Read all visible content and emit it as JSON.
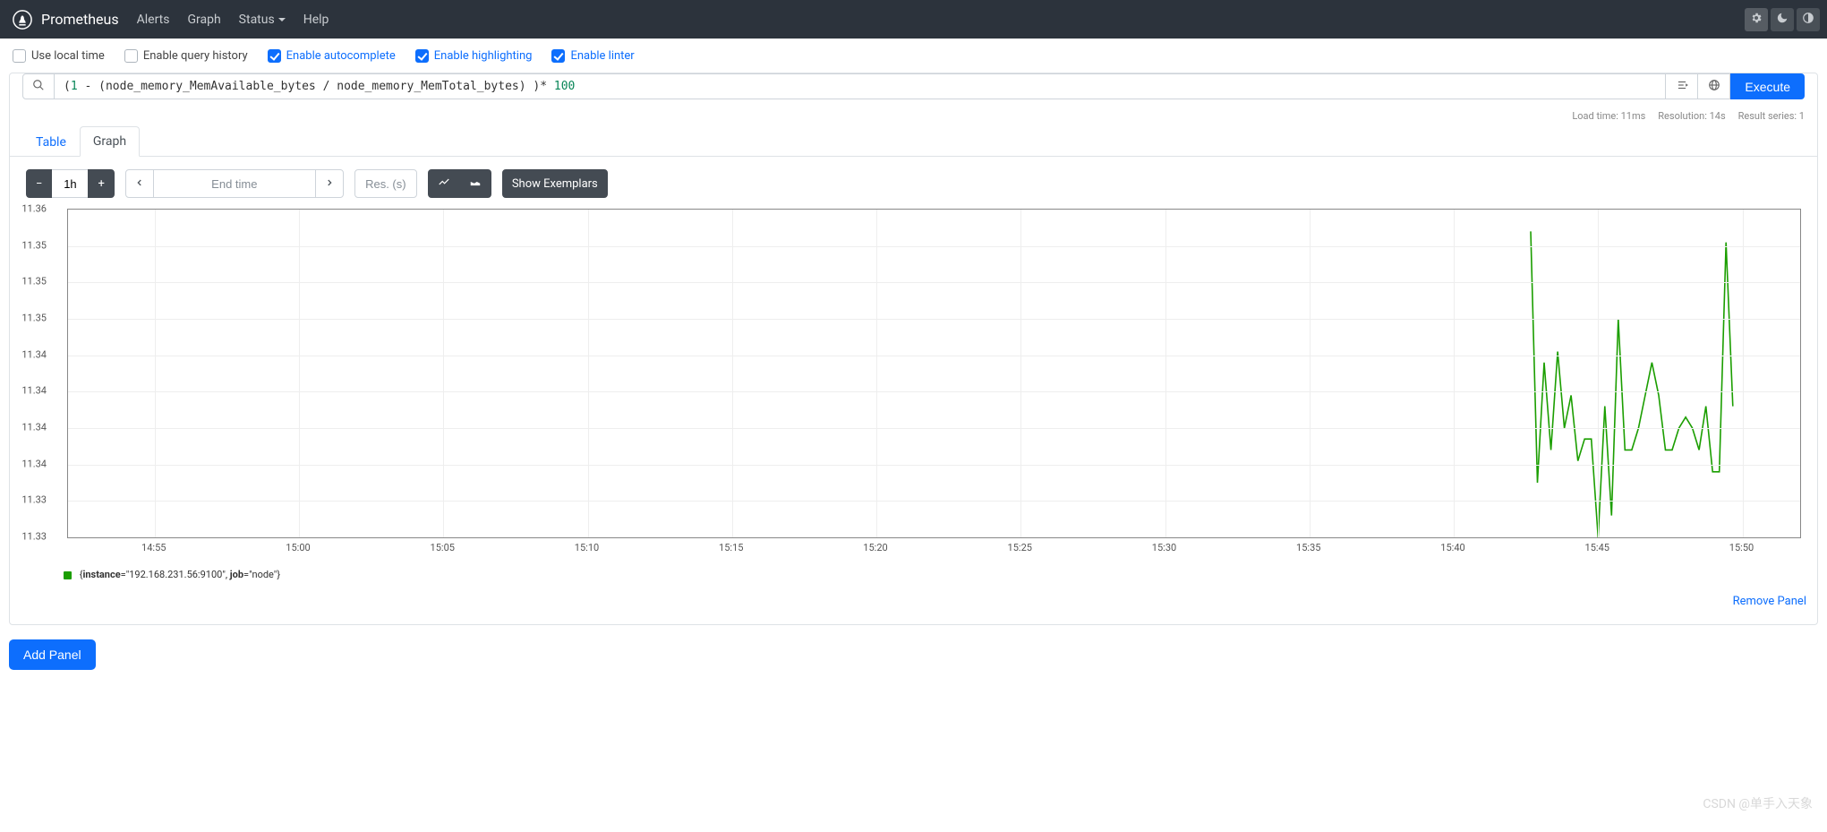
{
  "navbar": {
    "brand": "Prometheus",
    "links": [
      "Alerts",
      "Graph",
      "Status",
      "Help"
    ],
    "status_has_caret": true
  },
  "options": {
    "use_local_time": {
      "label": "Use local time",
      "checked": false
    },
    "enable_query_history": {
      "label": "Enable query history",
      "checked": false
    },
    "enable_autocomplete": {
      "label": "Enable autocomplete",
      "checked": true
    },
    "enable_highlighting": {
      "label": "Enable highlighting",
      "checked": true
    },
    "enable_linter": {
      "label": "Enable linter",
      "checked": true
    }
  },
  "query": {
    "expression": "(1 - (node_memory_MemAvailable_bytes / node_memory_MemTotal_bytes) )* 100",
    "execute_label": "Execute"
  },
  "stats": {
    "load_time": "Load time: 11ms",
    "resolution": "Resolution: 14s",
    "result_series": "Result series: 1"
  },
  "tabs": {
    "table": "Table",
    "graph": "Graph",
    "active": "graph"
  },
  "controls": {
    "range": "1h",
    "endtime_placeholder": "End time",
    "res_placeholder": "Res. (s)",
    "show_exemplars": "Show Exemplars"
  },
  "chart_data": {
    "type": "line",
    "title": "",
    "xlabel": "",
    "ylabel": "",
    "ylim": [
      11.33,
      11.36
    ],
    "y_ticks": [
      11.36,
      11.35,
      11.35,
      11.35,
      11.34,
      11.34,
      11.34,
      11.34,
      11.33,
      11.33
    ],
    "x_categories": [
      "14:55",
      "15:00",
      "15:05",
      "15:10",
      "15:15",
      "15:20",
      "15:25",
      "15:30",
      "15:35",
      "15:40",
      "15:45",
      "15:50"
    ],
    "series": [
      {
        "name": "{instance=\"192.168.231.56:9100\", job=\"node\"}",
        "points": [
          {
            "x": "15:42:40",
            "y": 11.358
          },
          {
            "x": "15:42:54",
            "y": 11.335
          },
          {
            "x": "15:43:08",
            "y": 11.346
          },
          {
            "x": "15:43:22",
            "y": 11.338
          },
          {
            "x": "15:43:36",
            "y": 11.347
          },
          {
            "x": "15:43:50",
            "y": 11.34
          },
          {
            "x": "15:44:04",
            "y": 11.343
          },
          {
            "x": "15:44:18",
            "y": 11.337
          },
          {
            "x": "15:44:32",
            "y": 11.339
          },
          {
            "x": "15:44:46",
            "y": 11.339
          },
          {
            "x": "15:45:00",
            "y": 11.33
          },
          {
            "x": "15:45:14",
            "y": 11.342
          },
          {
            "x": "15:45:28",
            "y": 11.332
          },
          {
            "x": "15:45:42",
            "y": 11.35
          },
          {
            "x": "15:45:56",
            "y": 11.338
          },
          {
            "x": "15:46:10",
            "y": 11.338
          },
          {
            "x": "15:46:24",
            "y": 11.34
          },
          {
            "x": "15:46:38",
            "y": 11.343
          },
          {
            "x": "15:46:52",
            "y": 11.346
          },
          {
            "x": "15:47:06",
            "y": 11.343
          },
          {
            "x": "15:47:20",
            "y": 11.338
          },
          {
            "x": "15:47:34",
            "y": 11.338
          },
          {
            "x": "15:47:48",
            "y": 11.34
          },
          {
            "x": "15:48:02",
            "y": 11.341
          },
          {
            "x": "15:48:16",
            "y": 11.34
          },
          {
            "x": "15:48:30",
            "y": 11.338
          },
          {
            "x": "15:48:44",
            "y": 11.342
          },
          {
            "x": "15:48:58",
            "y": 11.336
          },
          {
            "x": "15:49:12",
            "y": 11.336
          },
          {
            "x": "15:49:26",
            "y": 11.357
          },
          {
            "x": "15:49:40",
            "y": 11.342
          }
        ]
      }
    ]
  },
  "legend": {
    "instance_key": "instance",
    "instance_val": "\"192.168.231.56:9100\"",
    "job_key": "job",
    "job_val": "\"node\""
  },
  "footer": {
    "remove_panel": "Remove Panel",
    "add_panel": "Add Panel"
  },
  "watermark": "CSDN @单手入天象"
}
